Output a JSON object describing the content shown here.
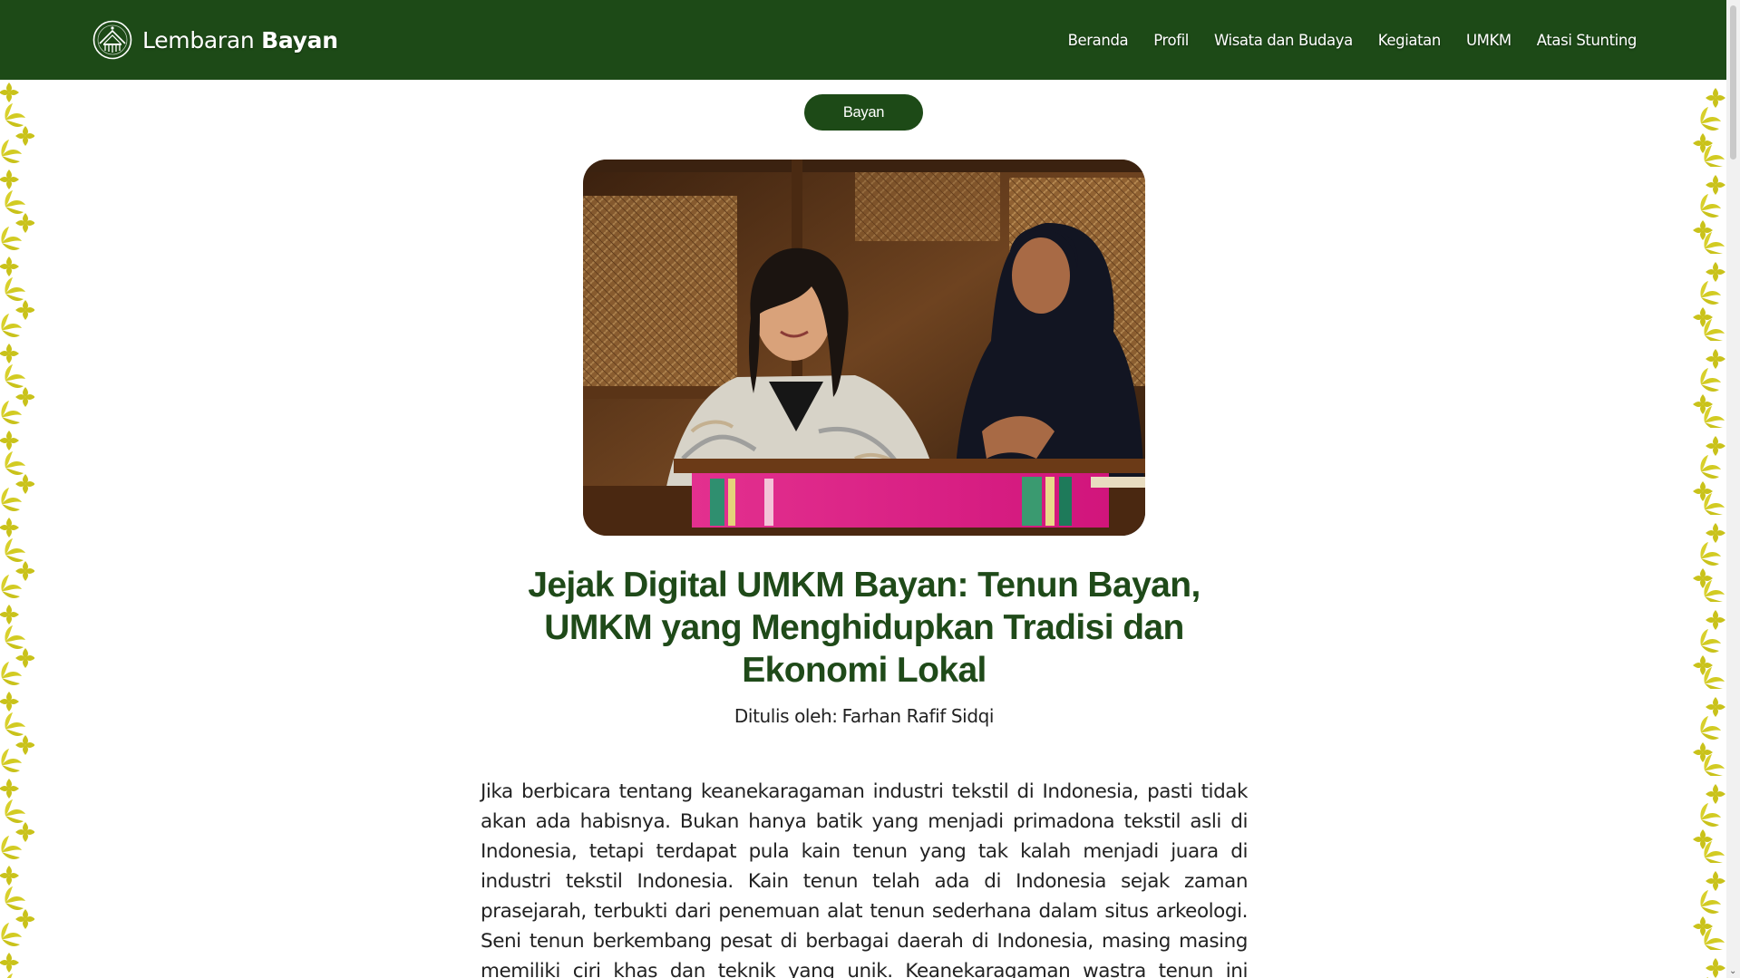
{
  "site": {
    "brand_light": "Lembaran",
    "brand_bold": "Bayan",
    "logo_icon": "village-emblem-icon"
  },
  "nav": {
    "items": [
      {
        "label": "Beranda"
      },
      {
        "label": "Profil"
      },
      {
        "label": "Wisata dan Budaya"
      },
      {
        "label": "Kegiatan"
      },
      {
        "label": "UMKM"
      },
      {
        "label": "Atasi Stunting"
      }
    ]
  },
  "article": {
    "tag": "Bayan",
    "title": "Jejak Digital UMKM Bayan: Tenun Bayan, UMKM yang Menghidupkan Tradisi dan Ekonomi Lokal",
    "byline_label": "Ditulis oleh:",
    "author": "Farhan Rafif Sidqi",
    "body": "Jika berbicara tentang keanekaragaman industri tekstil di Indonesia, pasti tidak akan ada habisnya. Bukan hanya batik yang menjadi primadona tekstil asli di Indonesia, tetapi terdapat pula kain tenun yang tak kalah menjadi juara di industri tekstil Indonesia. Kain tenun telah ada di Indonesia sejak zaman prasejarah, terbukti dari penemuan alat tenun sederhana dalam situs arkeologi. Seni tenun berkembang pesat di berbagai daerah di Indonesia, masing masing memiliki ciri khas dan teknik yang unik. Keanekaragaman wastra tenun ini muncul dari"
  },
  "colors": {
    "header_bg": "#1d4a17",
    "title_green": "#1f4a19",
    "deco_yellow": "#c9c21a"
  }
}
